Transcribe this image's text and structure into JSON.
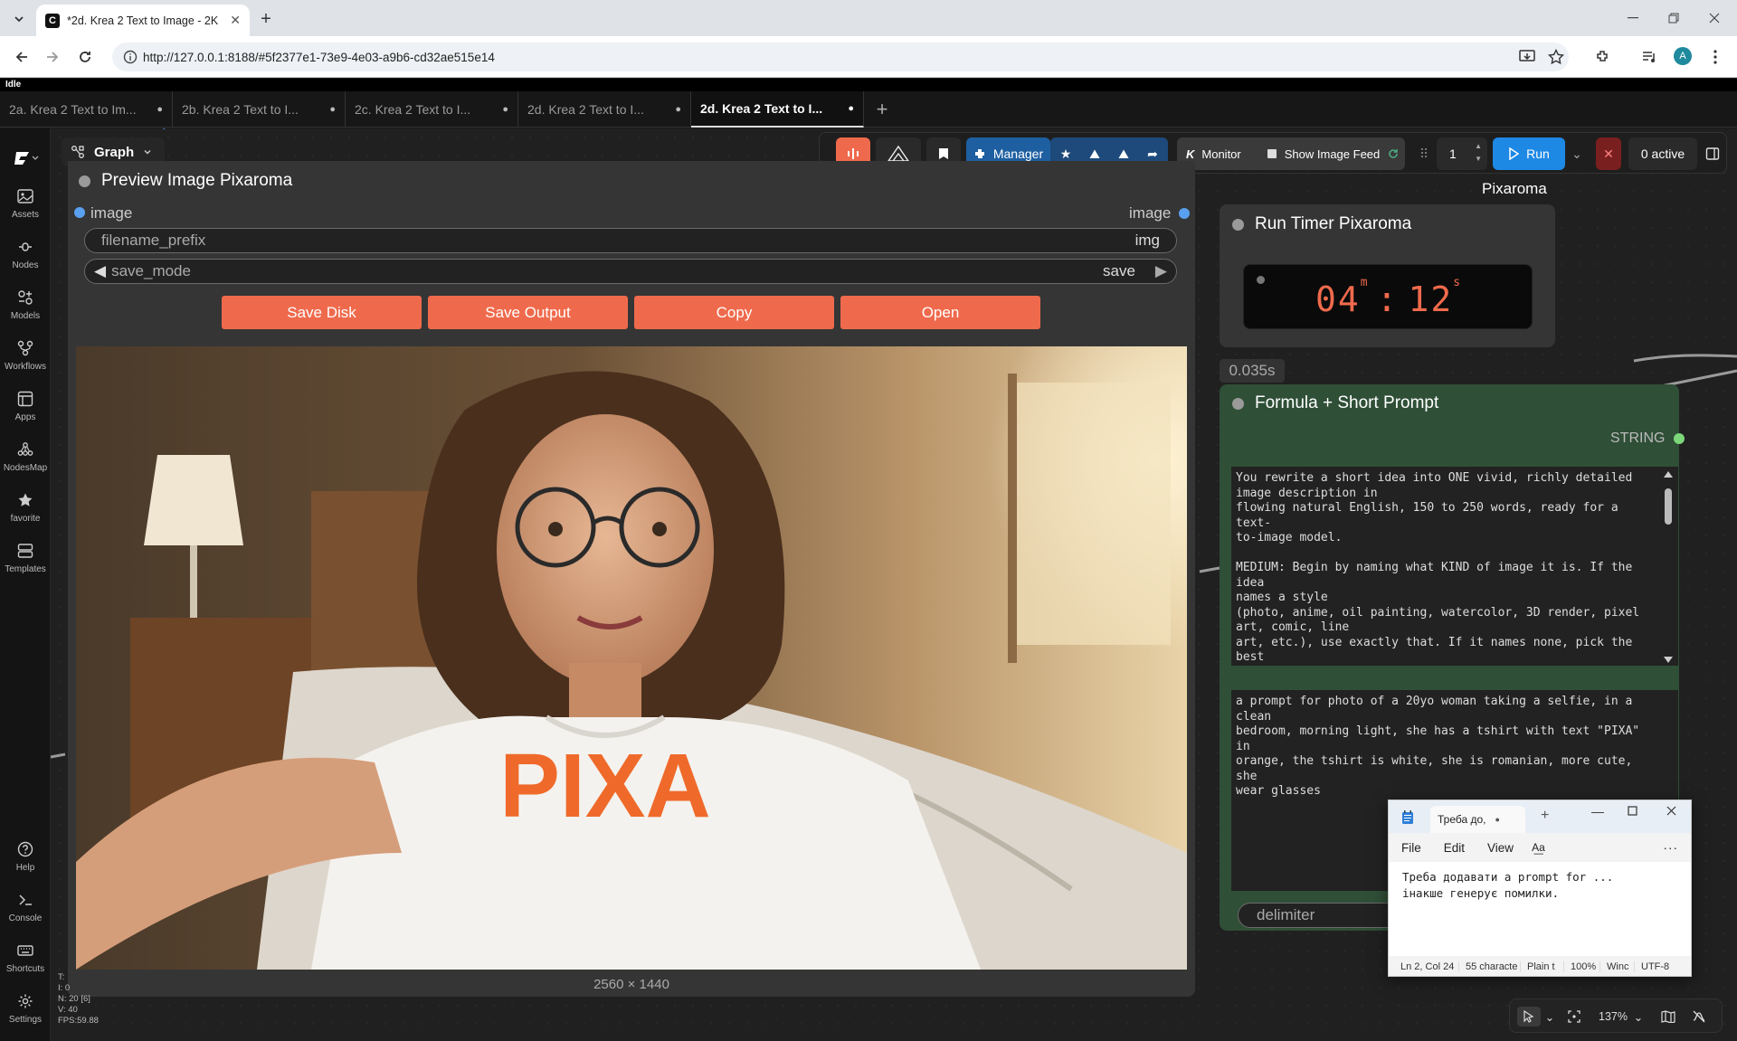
{
  "browser": {
    "tab_title": "*2d. Krea 2 Text to Image - 2K",
    "url": "http://127.0.0.1:8188/#5f2377e1-73e9-4e03-a9b6-cd32ae515e14",
    "profile_initial": "A"
  },
  "status_text": "Idle",
  "workflow_tabs": [
    {
      "label": "2a. Krea 2 Text to Im...",
      "active": false
    },
    {
      "label": "2b. Krea 2 Text to I...",
      "active": false
    },
    {
      "label": "2c. Krea 2 Text to I...",
      "active": false
    },
    {
      "label": "2d. Krea 2 Text to I...",
      "active": false
    },
    {
      "label": "2d. Krea 2 Text to I...",
      "active": true
    }
  ],
  "sidebar": {
    "items": [
      {
        "label": "Assets",
        "icon": "image-icon"
      },
      {
        "label": "Nodes",
        "icon": "nodes-icon"
      },
      {
        "label": "Models",
        "icon": "models-icon"
      },
      {
        "label": "Workflows",
        "icon": "workflows-icon"
      },
      {
        "label": "Apps",
        "icon": "apps-icon"
      },
      {
        "label": "NodesMap",
        "icon": "nodesmap-icon"
      },
      {
        "label": "favorite",
        "icon": "star-icon"
      },
      {
        "label": "Templates",
        "icon": "templates-icon"
      }
    ],
    "bottom": [
      {
        "label": "Help",
        "icon": "help-icon"
      },
      {
        "label": "Console",
        "icon": "console-icon"
      },
      {
        "label": "Shortcuts",
        "icon": "keyboard-icon"
      },
      {
        "label": "Settings",
        "icon": "gear-icon"
      }
    ]
  },
  "graph_menu_label": "Graph",
  "actionbar": {
    "manager_label": "Manager",
    "monitor_label": "Monitor",
    "show_feed_label": "Show Image Feed",
    "queue_count": "1",
    "run_label": "Run",
    "active_label": "0 active",
    "pixaroma_label": "Pixaroma"
  },
  "preview_node": {
    "title": "Preview Image Pixaroma",
    "input_label": "image",
    "output_label": "image",
    "filename_prefix_label": "filename_prefix",
    "filename_prefix_value": "img",
    "save_mode_label": "save_mode",
    "save_mode_value": "save",
    "buttons": [
      "Save Disk",
      "Save Output",
      "Copy",
      "Open"
    ],
    "image_dimensions": "2560 × 1440",
    "shirt_text": "PIXA"
  },
  "timer_node": {
    "title": "Run Timer Pixaroma",
    "minutes": "04",
    "seconds": "12",
    "min_unit": "m",
    "sec_unit": "s",
    "elapsed_badge": "0.035s"
  },
  "formula_node": {
    "title": "Formula + Short Prompt",
    "output_label": "STRING",
    "system_prompt": "You rewrite a short idea into ONE vivid, richly detailed\nimage description in\nflowing natural English, 150 to 250 words, ready for a text-\nto-image model.\n\nMEDIUM: Begin by naming what KIND of image it is. If the idea\nnames a style\n(photo, anime, oil painting, watercolor, 3D render, pixel\nart, comic, line\nart, etc.), use exactly that. If it names none, pick the best\nfit: for real\npeople, places, objects, or any true-to-life scene, make it a\nrealistic",
    "user_prompt": "a prompt for photo of a 20yo woman taking a selfie, in a clean\nbedroom, morning light, she has a tshirt with text \"PIXA\" in\norange, the tshirt is white, she is romanian, more cute, she\nwear glasses",
    "delimiter_label": "delimiter"
  },
  "notepad": {
    "tab_title": "Треба до,",
    "menu": [
      "File",
      "Edit",
      "View"
    ],
    "body": "Треба додавати a prompt for ...\nінакше генерує помилки.",
    "status": [
      "Ln 2, Col 24",
      "55 characte",
      "Plain t",
      "100%",
      "Winc",
      "UTF-8"
    ]
  },
  "stats": [
    "T:",
    "I: 0",
    "N: 20 [6]",
    "V: 40",
    "FPS:59.88"
  ],
  "zoom_level": "137%",
  "colors": {
    "accent": "#ef6a4c",
    "run_blue": "#1e88e5",
    "node_green": "#2f4f37"
  }
}
